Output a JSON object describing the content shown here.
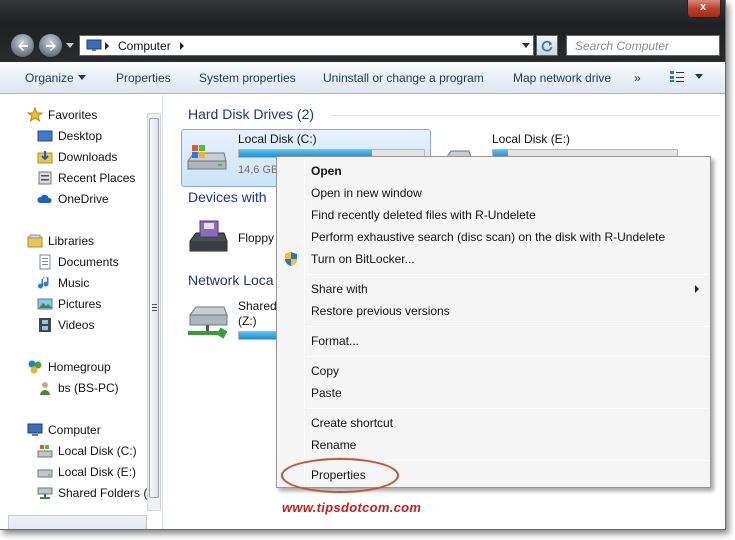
{
  "window": {
    "close_label": "x"
  },
  "address": {
    "crumb": "Computer",
    "search_placeholder": "Search Computer"
  },
  "toolbar": {
    "organize": "Organize",
    "properties": "Properties",
    "system_properties": "System properties",
    "uninstall": "Uninstall or change a program",
    "map_drive": "Map network drive",
    "more": "»"
  },
  "nav": {
    "favorites": "Favorites",
    "desktop": "Desktop",
    "downloads": "Downloads",
    "recent": "Recent Places",
    "onedrive": "OneDrive",
    "libraries": "Libraries",
    "documents": "Documents",
    "music": "Music",
    "pictures": "Pictures",
    "videos": "Videos",
    "homegroup": "Homegroup",
    "bs_pc": "bs (BS-PC)",
    "computer": "Computer",
    "local_c": "Local Disk (C:)",
    "local_e": "Local Disk (E:)",
    "shared": "Shared Folders (\\"
  },
  "content": {
    "hdd_header": "Hard Disk Drives (2)",
    "devices_header": "Devices with",
    "network_header": "Network Loca",
    "drive_c_label": "Local Disk (C:)",
    "drive_c_free": "14,6 GB",
    "drive_c_fill": 0.72,
    "drive_e_label": "Local Disk (E:)",
    "floppy_label": "Floppy",
    "shared_label": "Shared",
    "shared_sub": "(Z:)"
  },
  "menu": {
    "open": "Open",
    "open_new": "Open in new window",
    "r_undelete": "Find recently deleted files with R-Undelete",
    "r_scan": "Perform exhaustive search (disc scan) on the disk with R-Undelete",
    "bitlocker": "Turn on BitLocker...",
    "share_with": "Share with",
    "restore": "Restore previous versions",
    "format": "Format...",
    "copy": "Copy",
    "paste": "Paste",
    "create_shortcut": "Create shortcut",
    "rename": "Rename",
    "properties": "Properties"
  },
  "watermark": "www.tipsdotcom.com",
  "colors": {
    "accent": "#1e3287",
    "highlight_circle": "#b95a3d",
    "watermark": "#cc1a1a"
  }
}
